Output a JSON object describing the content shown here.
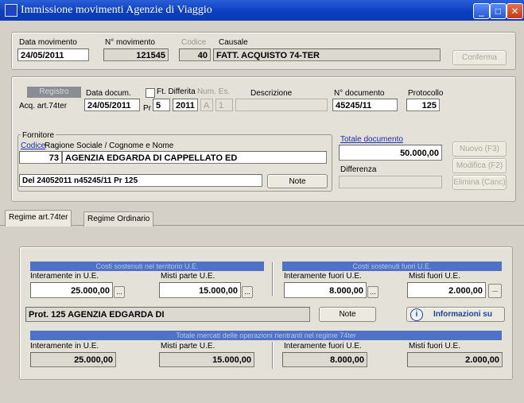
{
  "window": {
    "title": "Immissione movimenti Agenzie di Viaggio",
    "buttons": {
      "minimize": "_",
      "maximize": "□",
      "close": "✕"
    }
  },
  "top": {
    "data_movimento_label": "Data movimento",
    "data_movimento": "24/05/2011",
    "n_movimento_label": "N° movimento",
    "n_movimento": "121545",
    "codice_label": "Codice",
    "codice": "40",
    "causale_label": "Causale",
    "causale": "FATT. ACQUISTO 74-TER",
    "conferma": "Conferma"
  },
  "doc": {
    "registro_label": "Registro",
    "registro": "Acq. art.74ter",
    "data_doc_label": "Data docum.",
    "data_doc": "24/05/2011",
    "ft_differita_label": "Ft. Differita",
    "num_es_label": "Num. Es.",
    "pr_label": "Pr",
    "pr": "5",
    "anno": "2011",
    "cont_a": "A",
    "cont_b": "1",
    "descrizione_label": "Descrizione",
    "descrizione": "",
    "n_documento_label": "N° documento",
    "n_documento": "45245/11",
    "protocollo_label": "Protocollo",
    "protocollo": "125"
  },
  "fornitore": {
    "label": "Fornitore",
    "codice_label": "Codice",
    "ragione_label": "Ragione Sociale / Cognome e Nome",
    "codice": "73",
    "ragione": "AGENZIA EDGARDA DI CAPPELLATO ED",
    "descrizione": "Del 24052011 n45245/11 Pr  125",
    "note": "Note",
    "totale_label": "Totale documento",
    "totale": "50.000,00",
    "differenza_label": "Differenza",
    "differenza": "",
    "nuovo": "Nuovo (F3)",
    "modifica": "Modifica (F2)",
    "elimina": "Elimina (Canc)"
  },
  "tabs": {
    "tab1": "Regime art.74ter",
    "tab2": "Regime Ordinario"
  },
  "costi": {
    "interni_header": "Costi sostenuti nel territorio U.E.",
    "esterni_header": "Costi sostenuti fuori U.E.",
    "int_ue_label": "Interamente in U.E.",
    "int_ue": "25.000,00",
    "misti_ue_label": "Misti parte U.E.",
    "misti_ue": "15.000,00",
    "int_fuori_label": "Interamente fuori U.E.",
    "int_fuori": "8.000,00",
    "misti_fuori_label": "Misti fuori U.E.",
    "misti_fuori": "2.000,00",
    "ellipsis": "...",
    "prot_line": "Prot.  125 AGENZIA EDGARDA DI",
    "note": "Note",
    "info": "Informazioni su"
  },
  "totali": {
    "header": "Totale mercati delle operazioni rientranti nel regime 74ter",
    "int_ue_label": "Interamente in U.E.",
    "int_ue": "25.000,00",
    "misti_ue_label": "Misti parte U.E.",
    "misti_ue": "15.000,00",
    "int_fuori_label": "Interamente fuori U.E.",
    "int_fuori": "8.000,00",
    "misti_fuori_label": "Misti fuori U.E.",
    "misti_fuori": "2.000,00"
  }
}
